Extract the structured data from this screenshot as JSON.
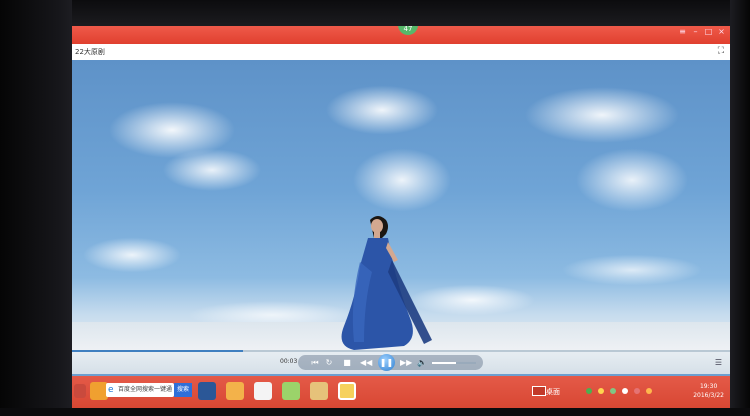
{
  "player": {
    "badge": "47",
    "title": "22大原剧",
    "fullscreen_icon": "⛶",
    "time": "00:03",
    "progress": 0.26,
    "volume": 0.55
  },
  "controls": {
    "prev_label": "⏮",
    "next_label": "⏭",
    "stop_label": "■",
    "play_label": "❚❚",
    "volume_icon_label": "🔈"
  },
  "taskbar": {
    "search_placeholder": "百度全网搜索一键通",
    "search_button": "搜索",
    "tray_label": "桌面",
    "clock_time": "19:30",
    "clock_date": "2016/3/22"
  },
  "colors": {
    "titlebar": "#e0402f",
    "taskbar": "#d84733",
    "accent": "#3f7fc0"
  }
}
